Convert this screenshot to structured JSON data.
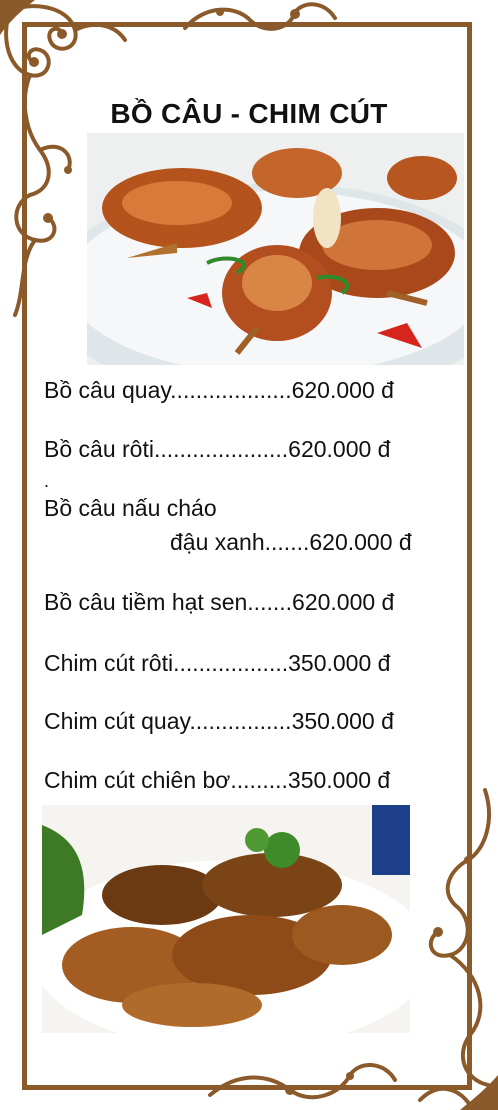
{
  "menu": {
    "title": "BỒ CÂU - CHIM CÚT",
    "items": [
      {
        "name": "Bồ câu quay",
        "dots": "...................",
        "price": "620.000 đ"
      },
      {
        "name": "Bồ câu rôti",
        "dots": ".....................",
        "price": "620.000 đ"
      },
      {
        "name_line1": "Bồ câu nấu cháo",
        "name_line2": "đậu xanh",
        "dots": ".......",
        "price": "620.000 đ"
      },
      {
        "name": "Bồ câu tiềm hạt sen",
        "dots": ".......",
        "price": "620.000 đ"
      },
      {
        "name": "Chim cút rôti",
        "dots": "..................",
        "price": "350.000 đ"
      },
      {
        "name": "Chim cút quay",
        "dots": "................",
        "price": "350.000 đ"
      },
      {
        "name": "Chim cút chiên bơ",
        "dots": ".........",
        "price": "350.000 đ"
      }
    ],
    "stray_mark": "."
  },
  "colors": {
    "frame": "#8b5a2b",
    "text": "#111111",
    "background": "#ffffff"
  },
  "images": {
    "top": "roasted-pigeon-photo",
    "bottom": "fried-quail-photo"
  }
}
